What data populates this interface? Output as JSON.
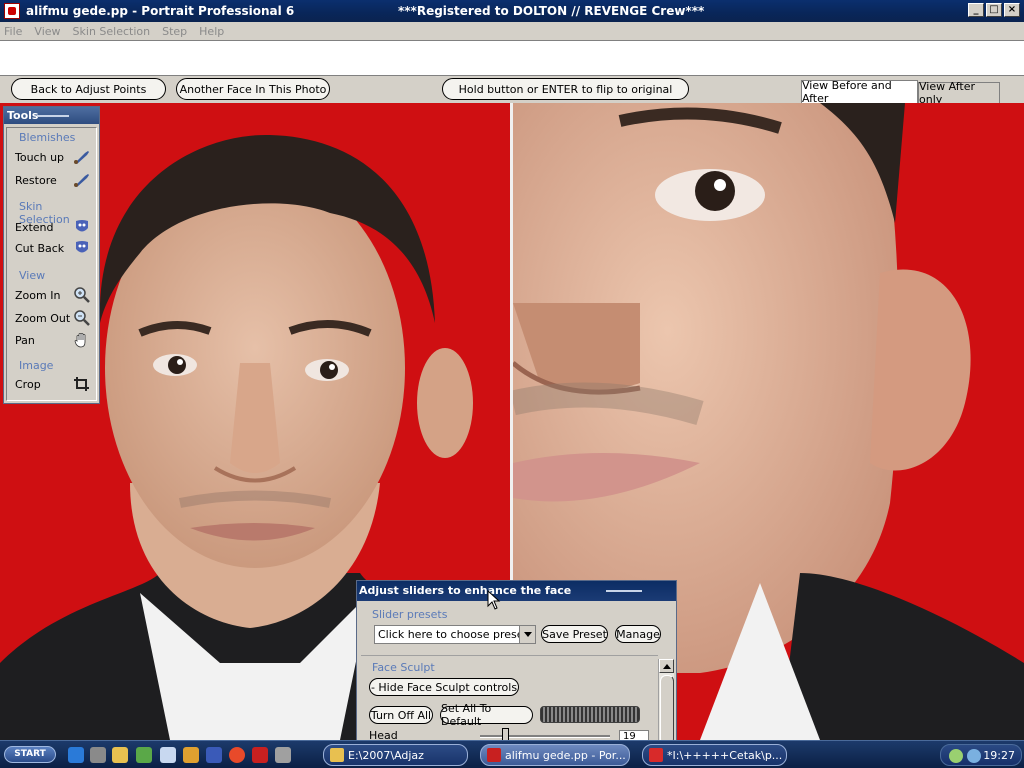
{
  "window": {
    "title": "alifmu gede.pp - Portrait Professional 6",
    "registration": "***Registered to DOLTON // REVENGE Crew***",
    "controls": [
      "_",
      "□",
      "×"
    ]
  },
  "menu": [
    "File",
    "View",
    "Skin Selection",
    "Step",
    "Help"
  ],
  "buttons": {
    "back": "Back to Adjust Points",
    "another_face": "Another Face In This Photo",
    "hold_flip": "Hold button or ENTER to flip to original"
  },
  "view_tabs": [
    {
      "label": "View Before and After",
      "active": true
    },
    {
      "label": "View After only",
      "active": false
    }
  ],
  "tools": {
    "title": "Tools",
    "sections": [
      {
        "label": "Blemishes",
        "items": [
          {
            "label": "Touch up",
            "icon": "brush-icon"
          },
          {
            "label": "Restore",
            "icon": "brush-icon"
          }
        ]
      },
      {
        "label": "Skin Selection",
        "items": [
          {
            "label": "Extend",
            "icon": "mask-icon"
          },
          {
            "label": "Cut Back",
            "icon": "mask-icon"
          }
        ]
      },
      {
        "label": "View",
        "items": [
          {
            "label": "Zoom In",
            "icon": "magnifier-plus-icon"
          },
          {
            "label": "Zoom Out",
            "icon": "magnifier-minus-icon"
          },
          {
            "label": "Pan",
            "icon": "hand-icon"
          }
        ]
      },
      {
        "label": "Image",
        "items": [
          {
            "label": "Crop",
            "icon": "crop-icon"
          }
        ]
      }
    ]
  },
  "adjust_panel": {
    "title": "Adjust sliders to enhance the face",
    "presets_label": "Slider presets",
    "preset_select": "Click here to choose preset",
    "save_preset": "Save Preset",
    "manage": "Manage",
    "face_sculpt_label": "Face Sculpt",
    "hide_controls": "- Hide Face Sculpt controls",
    "turn_off_all": "Turn Off All",
    "set_all_default": "Set All To Default",
    "head_label": "Head",
    "head_value": "19"
  },
  "taskbar": {
    "start": "START",
    "tasks": [
      {
        "label": "E:\\2007\\Adjaz",
        "active": false
      },
      {
        "label": "alifmu gede.pp - Por...",
        "active": true
      },
      {
        "label": "*I:\\+++++Cetak\\p...",
        "active": false
      }
    ],
    "clock": "19:27"
  },
  "colors": {
    "background_red": "#cf0f12",
    "titlebar": "#0b2f6e",
    "taskbar": "#0b2045",
    "section_label": "#5a7ab8"
  }
}
